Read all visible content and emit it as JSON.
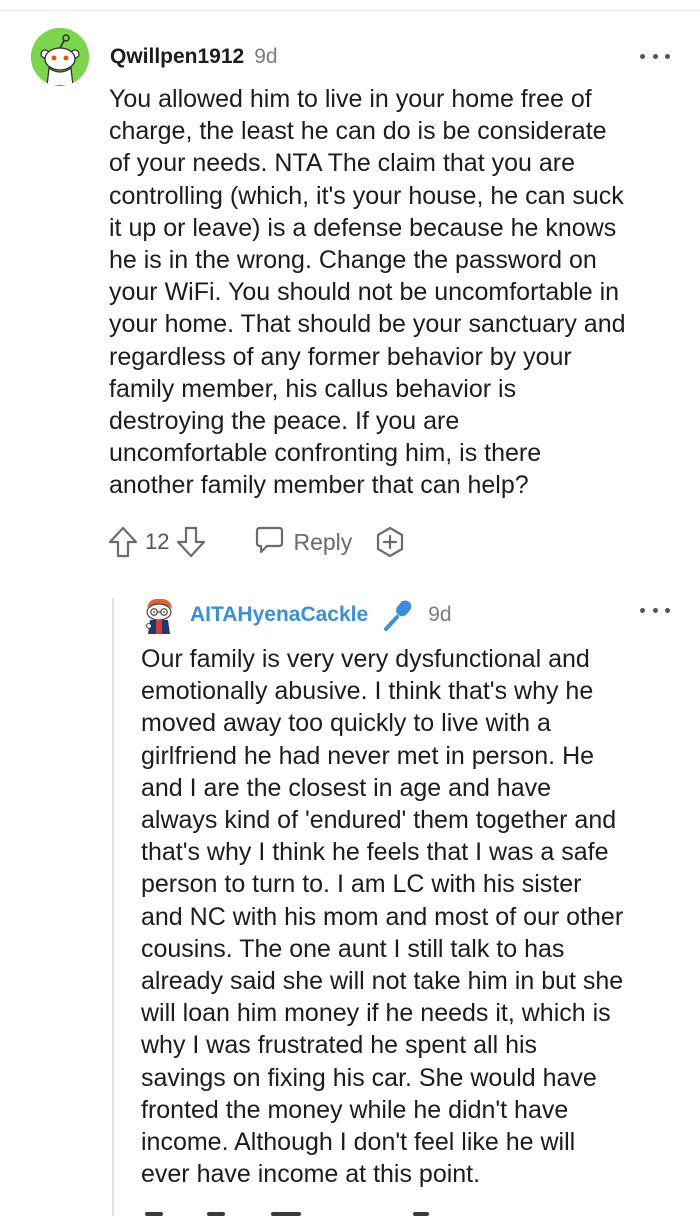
{
  "comment": {
    "username": "Qwillpen1912",
    "age": "9d",
    "body_lines": [
      "You allowed him to live in your home free of",
      "charge, the least he can do is be considerate",
      "of your needs. NTA The claim that you are",
      "controlling (which, it's your house, he can suck",
      "it up or leave) is a defense because he knows",
      "he is in the wrong. Change the password on",
      "your WiFi. You should not be uncomfortable in",
      "your home. That should be your sanctuary and",
      "regardless of any former behavior by your",
      "family member, his callus behavior is",
      "destroying the peace. If you are",
      "uncomfortable confronting him, is there",
      "another family member that can help?"
    ],
    "vote_count": "12",
    "reply_label": "Reply",
    "icons": {
      "avatar": "reddit-snoo-avatar-icon",
      "more": "more-options-icon",
      "upvote": "upvote-arrow-icon",
      "downvote": "downvote-arrow-icon",
      "reply": "reply-bubble-icon",
      "award": "award-plus-icon"
    },
    "avatar_color": "#7dd44e"
  },
  "reply": {
    "username": "AITAHyenaCackle",
    "age": "9d",
    "username_color": "#3b8fd8",
    "body_lines": [
      "Our family is very very dysfunctional and",
      "emotionally abusive. I think that's why he",
      "moved away too quickly to live with a",
      "girlfriend he had never met in person. He",
      "and I are the closest in age and have",
      "always kind of 'endured' them together and",
      "that's why I think he feels that I was a safe",
      "person to turn to. I am LC with his sister",
      "and NC with his mom and most of our other",
      "cousins. The one aunt I still talk to has",
      "already said she will not take him in but she",
      "will loan him money if he needs it, which is",
      "why I was frustrated he spent all his",
      "savings on fixing his car. She would have",
      "fronted the money while he didn't have",
      "income. Although I don't feel like he will",
      "ever have income at this point."
    ],
    "icons": {
      "avatar": "custom-snoo-avatar-icon",
      "badge": "microphone-icon",
      "more": "more-options-icon"
    }
  }
}
